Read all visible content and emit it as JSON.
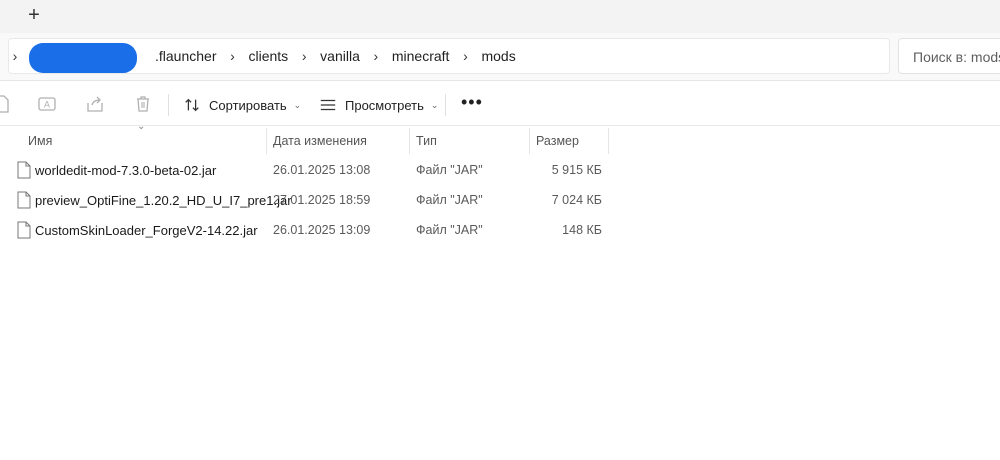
{
  "tabbar": {
    "add_label": "+"
  },
  "breadcrumb": {
    "items": [
      ".flauncher",
      "clients",
      "vanilla",
      "minecraft",
      "mods"
    ],
    "separator": "›"
  },
  "search": {
    "placeholder": "Поиск в: mods"
  },
  "commandbar": {
    "sort_label": "Сортировать",
    "view_label": "Просмотреть",
    "more_label": "•••"
  },
  "columns": {
    "name": "Имя",
    "date": "Дата изменения",
    "type": "Тип",
    "size": "Размер"
  },
  "files": [
    {
      "name": "worldedit-mod-7.3.0-beta-02.jar",
      "date": "26.01.2025 13:08",
      "type": "Файл \"JAR\"",
      "size": "5 915 КБ"
    },
    {
      "name": "preview_OptiFine_1.20.2_HD_U_I7_pre1.jar",
      "date": "27.01.2025 18:59",
      "type": "Файл \"JAR\"",
      "size": "7 024 КБ"
    },
    {
      "name": "CustomSkinLoader_ForgeV2-14.22.jar",
      "date": "26.01.2025 13:09",
      "type": "Файл \"JAR\"",
      "size": "148 КБ"
    }
  ],
  "icons": {
    "new": "file-icon",
    "rename": "rename-icon",
    "share": "share-icon",
    "delete": "trash-icon",
    "sort": "sort-icon",
    "view": "view-lines-icon",
    "file": "file-icon"
  },
  "colors": {
    "redaction": "#1a6fe8"
  }
}
